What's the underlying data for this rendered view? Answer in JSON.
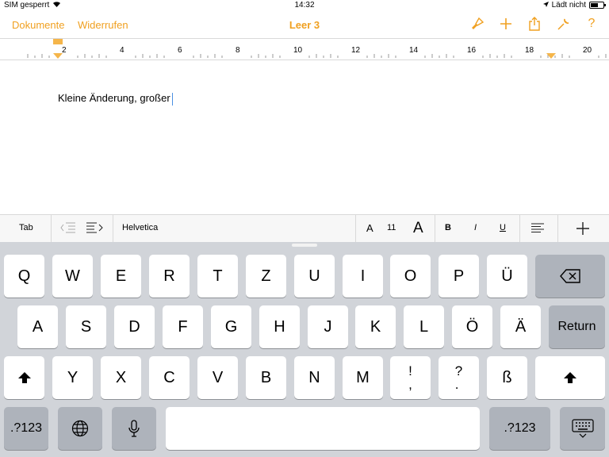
{
  "status": {
    "carrier": "SIM gesperrt",
    "time": "14:32",
    "charging": "Lädt nicht"
  },
  "nav": {
    "documents": "Dokumente",
    "undo": "Widerrufen",
    "title": "Leer 3"
  },
  "ruler": {
    "numbers": [
      "2",
      "4",
      "6",
      "8",
      "10",
      "12",
      "14",
      "16",
      "18",
      "20"
    ]
  },
  "document": {
    "text": "Kleine Änderung, großer"
  },
  "format": {
    "tab": "Tab",
    "font": "Helvetica",
    "size_small": "A",
    "size_value": "11",
    "size_large": "A",
    "bold": "B",
    "italic": "I",
    "underline": "U"
  },
  "keyboard": {
    "row1": [
      "Q",
      "W",
      "E",
      "R",
      "T",
      "Z",
      "U",
      "I",
      "O",
      "P",
      "Ü"
    ],
    "row2": [
      "A",
      "S",
      "D",
      "F",
      "G",
      "H",
      "J",
      "K",
      "L",
      "Ö",
      "Ä"
    ],
    "row3": [
      "Y",
      "X",
      "C",
      "V",
      "B",
      "N",
      "M",
      "!\n,",
      "?\n.",
      "ß"
    ],
    "return": "Return",
    "numbers": ".?123"
  }
}
